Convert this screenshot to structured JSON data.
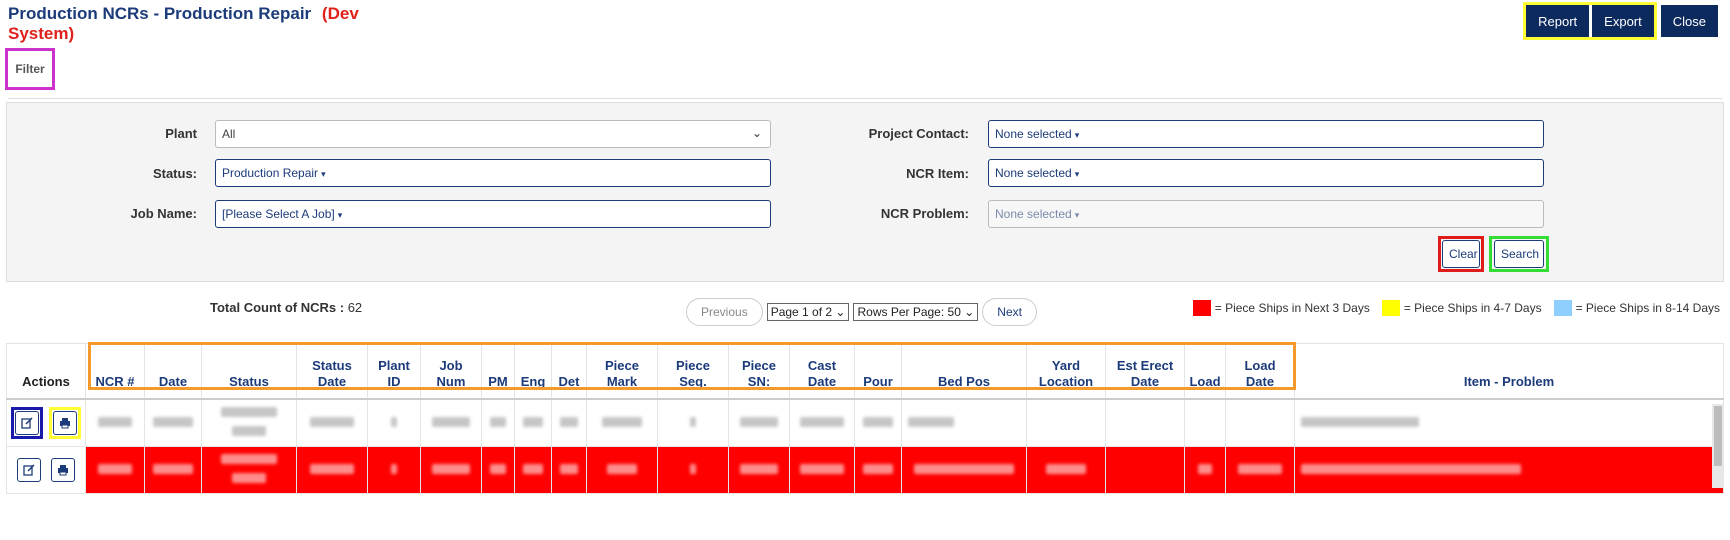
{
  "page": {
    "title": "Production NCRs - Production Repair",
    "system_tag_line1": "(Dev",
    "system_tag_line2": "System)"
  },
  "toolbar": {
    "report_label": "Report",
    "export_label": "Export",
    "close_label": "Close"
  },
  "tabs": {
    "filter_label": "Filter"
  },
  "filters": {
    "plant_label": "Plant",
    "plant_value": "All",
    "status_label": "Status:",
    "status_value": "Production Repair",
    "job_name_label": "Job Name:",
    "job_name_value": "[Please Select A Job]",
    "project_contact_label": "Project Contact:",
    "project_contact_value": "None selected",
    "ncr_item_label": "NCR Item:",
    "ncr_item_value": "None selected",
    "ncr_problem_label": "NCR Problem:",
    "ncr_problem_value": "None selected",
    "clear_label": "Clear",
    "search_label": "Search"
  },
  "summary": {
    "total_label": "Total Count of NCRs :",
    "total_value": "62"
  },
  "pagination": {
    "previous_label": "Previous",
    "page_select_value": "Page 1 of 2",
    "rows_select_value": "Rows Per Page: 50",
    "next_label": "Next"
  },
  "legend": [
    {
      "color": "#ff0000",
      "text": "= Piece Ships in Next 3 Days"
    },
    {
      "color": "#ffff00",
      "text": "= Piece Ships in 4-7 Days"
    },
    {
      "color": "#8ecfff",
      "text": "= Piece Ships in 8-14 Days"
    }
  ],
  "table": {
    "columns": [
      "Actions",
      "NCR #",
      "Date",
      "Status",
      "Status Date",
      "Plant ID",
      "Job Num",
      "PM",
      "Eng",
      "Det",
      "Piece Mark",
      "Piece Seq.",
      "Piece SN:",
      "Cast Date",
      "Pour",
      "Bed Pos",
      "Yard Location",
      "Est Erect Date",
      "Load",
      "Load Date",
      "Item - Problem"
    ],
    "row_highlight_color": "#ff0000"
  },
  "icons": {
    "edit": "edit-icon",
    "print": "print-icon"
  }
}
